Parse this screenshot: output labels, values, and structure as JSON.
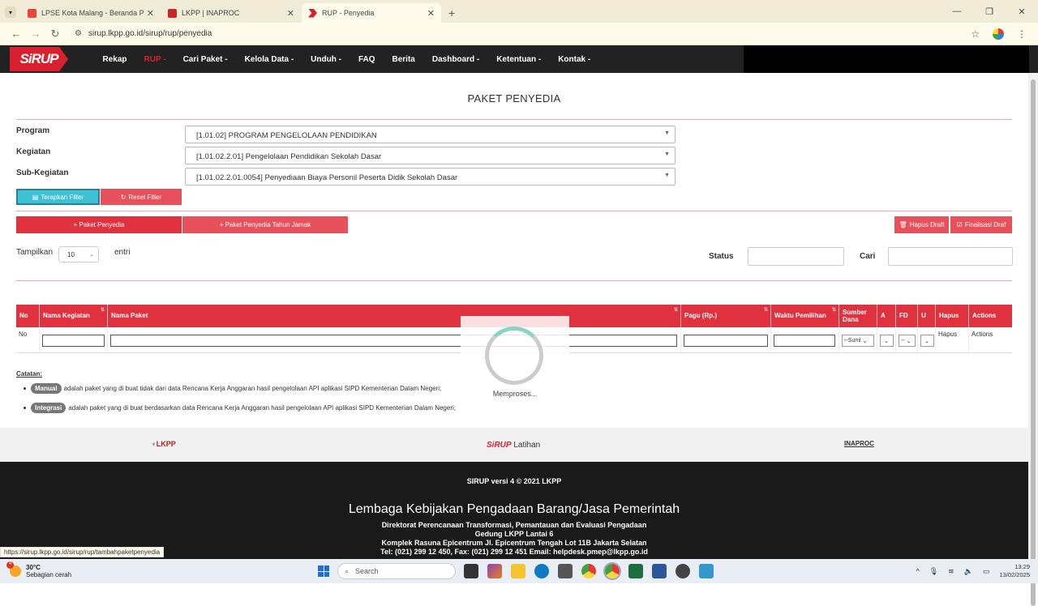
{
  "browser": {
    "tabs": [
      {
        "title": "LPSE Kota Malang - Beranda PF",
        "color": "#e8453c"
      },
      {
        "title": "LKPP | INAPROC",
        "color": "#c62828"
      },
      {
        "title": "RUP - Penyedia",
        "color": "#d9202e"
      }
    ],
    "url": "sirup.lkpp.go.id/sirup/rup/penyedia",
    "status_url": "https://sirup.lkpp.go.id/sirup/rup/tambahpaketpenyedia"
  },
  "navbar": {
    "logo": "SiRUP",
    "items": [
      "Rekap",
      "RUP -",
      "Cari Paket -",
      "Kelola Data -",
      "Unduh -",
      "FAQ",
      "Berita",
      "Dashboard -",
      "Ketentuan -",
      "Kontak -"
    ]
  },
  "page": {
    "title": "PAKET PENYEDIA",
    "filters": [
      {
        "label": "Program",
        "value": "[1.01.02] PROGRAM PENGELOLAAN PENDIDIKAN"
      },
      {
        "label": "Kegiatan",
        "value": "[1.01.02.2.01] Pengelolaan Pendidikan Sekolah Dasar"
      },
      {
        "label": "Sub-Kegiatan",
        "value": "[1.01.02.2.01.0054] Penyediaan Biaya Personil Peserta Didik Sekolah Dasar"
      }
    ],
    "btn_apply": "Terapkan Filter",
    "btn_reset": "Reset Filter",
    "btn_add": "+ Paket Penyedia",
    "btn_add_multi": "+ Paket Penyedia Tahun Jamak",
    "btn_delete_draft": "Hapus Draft",
    "btn_finalize_draft": "Finalisasi Draf",
    "show_label": "Tampilkan",
    "show_value": "10",
    "entries_label": "entri",
    "status_label": "Status",
    "search_label": "Cari"
  },
  "table": {
    "headers": [
      "No",
      "Nama Kegiatan",
      "Nama Paket",
      "Pagu (Rp.)",
      "Waktu Pemilihan",
      "Sumber Dana",
      "A",
      "FD",
      "U",
      "Hapus",
      "Actions"
    ],
    "filter_row": {
      "no": "No",
      "sumber": "--Suml",
      "a": "",
      "fd": "--",
      "u": "",
      "hapus": "Hapus",
      "actions": "Actions"
    }
  },
  "loading": {
    "text": "Memproses..."
  },
  "notes": {
    "heading": "Catatan:",
    "items": [
      {
        "pill": "Manual",
        "text": "adalah paket yang di buat tidak dari data Rencana Kerja Anggaran hasil pengelolaan API aplikasi SIPD Kementerian Dalam Negeri;"
      },
      {
        "pill": "Integrasi",
        "text": "adalah paket yang di buat berdasarkan data Rencana Kerja Anggaran hasil pengelolaan API aplikasi SIPD Kementerian Dalam Negeri;"
      }
    ]
  },
  "footer": {
    "partner_left": "LKPP",
    "partner_mid": "SiRUP",
    "partner_mid_suffix": "Latihan",
    "partner_right": "INAPROC",
    "version": "SIRUP versi 4 © 2021 LKPP",
    "org": "Lembaga Kebijakan Pengadaan Barang/Jasa Pemerintah",
    "dir": "Direktorat Perencanaan Transformasi, Pemantauan dan Evaluasi Pengadaan",
    "building": "Gedung LKPP Lantai 6",
    "address": "Komplek Rasuna Epicentrum Jl. Epicentrum Tengah Lot 11B Jakarta Selatan",
    "contact": "Tel: (021) 299 12 450, Fax: (021) 299 12 451 Email: helpdesk.pmep@lkpp.go.id"
  },
  "taskbar": {
    "temp": "30°C",
    "weather": "Sebagian cerah",
    "badge": "4",
    "search_placeholder": "Search",
    "time": "13:29",
    "date": "13/02/2025"
  }
}
